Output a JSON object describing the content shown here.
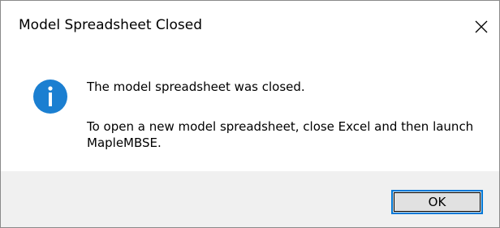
{
  "dialog": {
    "title": "Model Spreadsheet Closed",
    "close_icon": "close-icon",
    "message_icon": "information-icon",
    "message_line1": "The model spreadsheet was closed.",
    "message_line2": "To open a new model spreadsheet, close Excel and then launch MapleMBSE.",
    "ok_label": "OK"
  },
  "colors": {
    "accent": "#0078d7",
    "footer_bg": "#f0f0f0",
    "button_bg": "#e1e1e1",
    "icon_bg": "#1b7fd1"
  }
}
